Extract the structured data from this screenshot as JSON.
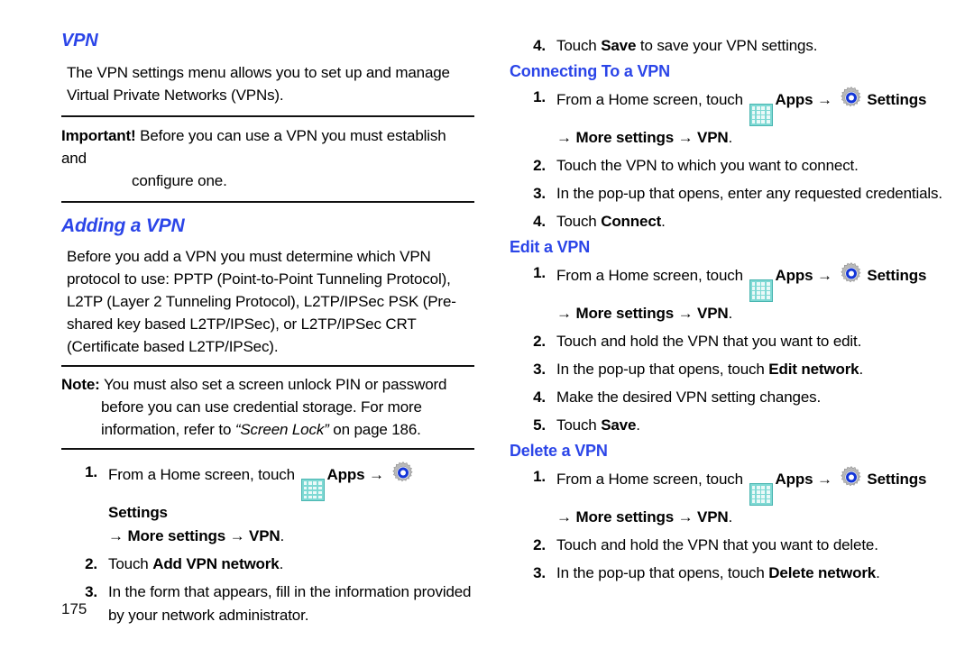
{
  "page": {
    "number": "175",
    "icons": {
      "apps": "apps-grid-icon",
      "settings": "settings-gear-icon",
      "arrow": "→"
    },
    "colors": {
      "heading_blue": "#2B45E8",
      "rule_black": "#111111",
      "apps_icon_teal": "#7ED9D4",
      "settings_icon_blue": "#1436D8"
    }
  },
  "left": {
    "title": "VPN",
    "intro": "The VPN settings menu allows you to set up and manage Virtual Private Networks (VPNs).",
    "important": {
      "label": "Important!",
      "line1": "Before you can use a VPN you must establish and",
      "line2": "configure one."
    },
    "section_adding": "Adding a VPN",
    "adding_intro": "Before you add a VPN you must determine which VPN protocol to use: PPTP (Point-to-Point Tunneling Protocol), L2TP (Layer 2 Tunneling Protocol), L2TP/IPSec PSK (Pre-shared key based L2TP/IPSec), or L2TP/IPSec CRT (Certificate based L2TP/IPSec).",
    "note": {
      "label": "Note:",
      "line1": "You must also set a screen unlock PIN or password",
      "line2": "before you can use credential storage. For more",
      "line3_pre": "information, refer to ",
      "line3_italic": "“Screen Lock”",
      "line3_post": " on page 186."
    },
    "steps": [
      {
        "num": "1.",
        "pre": "From a Home screen, touch ",
        "apps_label": "Apps",
        "settings_label": "Settings",
        "path_more": "More settings",
        "path_vpn": "VPN",
        "period": "."
      },
      {
        "num": "2.",
        "pre": "Touch ",
        "bold": "Add VPN network",
        "post": "."
      },
      {
        "num": "3.",
        "pre": "In the form that appears, fill in the information provided by your network administrator.",
        "bold": "",
        "post": ""
      }
    ]
  },
  "right": {
    "step_save": {
      "num": "4.",
      "pre": "Touch ",
      "bold": "Save",
      "post": " to save your VPN settings."
    },
    "section_connecting": "Connecting To a VPN",
    "connecting_steps": [
      {
        "num": "1.",
        "pre": "From a Home screen, touch ",
        "apps_label": "Apps",
        "settings_label": "Settings",
        "path_more": "More settings",
        "path_vpn": "VPN",
        "period": "."
      },
      {
        "num": "2.",
        "pre": "Touch the VPN to which you want to connect.",
        "bold": "",
        "post": ""
      },
      {
        "num": "3.",
        "pre": "In the pop-up that opens, enter any requested credentials.",
        "bold": "",
        "post": ""
      },
      {
        "num": "4.",
        "pre": "Touch ",
        "bold": "Connect",
        "post": "."
      }
    ],
    "section_edit": "Edit a VPN",
    "edit_steps": [
      {
        "num": "1.",
        "pre": "From a Home screen, touch ",
        "apps_label": "Apps",
        "settings_label": "Settings",
        "path_more": "More settings",
        "path_vpn": "VPN",
        "period": "."
      },
      {
        "num": "2.",
        "pre": "Touch and hold the VPN that you want to edit.",
        "bold": "",
        "post": ""
      },
      {
        "num": "3.",
        "pre": "In the pop-up that opens, touch ",
        "bold": "Edit network",
        "post": "."
      },
      {
        "num": "4.",
        "pre": "Make the desired VPN setting changes.",
        "bold": "",
        "post": ""
      },
      {
        "num": "5.",
        "pre": "Touch ",
        "bold": "Save",
        "post": "."
      }
    ],
    "section_delete": "Delete a VPN",
    "delete_steps": [
      {
        "num": "1.",
        "pre": "From a Home screen, touch ",
        "apps_label": "Apps",
        "settings_label": "Settings",
        "path_more": "More settings",
        "path_vpn": "VPN",
        "period": "."
      },
      {
        "num": "2.",
        "pre": "Touch and hold the VPN that you want to delete.",
        "bold": "",
        "post": ""
      },
      {
        "num": "3.",
        "pre": "In the pop-up that opens, touch ",
        "bold": "Delete network",
        "post": "."
      }
    ]
  }
}
